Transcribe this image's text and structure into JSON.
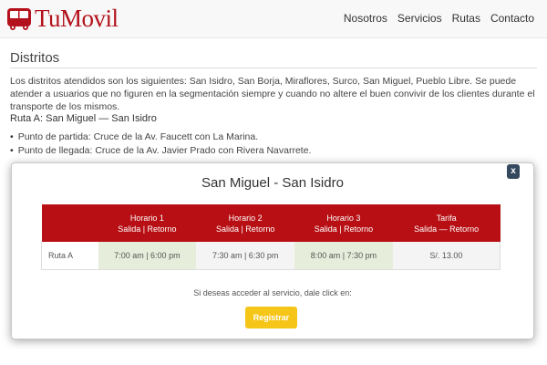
{
  "brand": {
    "name": "TuMovil",
    "color": "#b3121c"
  },
  "nav": {
    "items": [
      "Nosotros",
      "Servicios",
      "Rutas",
      "Contacto"
    ]
  },
  "page": {
    "title": "Distritos",
    "intro": "Los distritos atendidos son los siguientes: San Isidro, San Borja, Miraflores, Surco, San Miguel, Pueblo Libre. Se puede atender a usuarios que no figuren en la segmentación siempre y cuando no altere el buen convivir de los clientes durante el transporte de los mismos.",
    "route_heading": "Ruta A: San Miguel — San Isidro",
    "route_points": [
      "Punto de partida: Cruce de la Av. Faucett con La Marina.",
      "Punto de llegada: Cruce de la Av. Javier Prado con Rivera Navarrete."
    ]
  },
  "modal": {
    "close_label": "x",
    "title": "San Miguel - San Isidro",
    "table": {
      "headers": [
        {
          "title": "",
          "sub": ""
        },
        {
          "title": "Horario 1",
          "sub": "Salida | Retorno"
        },
        {
          "title": "Horario 2",
          "sub": "Salida | Retorno"
        },
        {
          "title": "Horario 3",
          "sub": "Salida | Retorno"
        },
        {
          "title": "Tarifa",
          "sub": "Salida — Retorno"
        }
      ],
      "row": {
        "label": "Ruta A",
        "cells": [
          "7:00 am | 6:00 pm",
          "7:30 am | 6:30 pm",
          "8:00 am | 7:30 pm",
          "S/. 13.00"
        ]
      },
      "header_color": "#b70f13"
    },
    "register_text": "Si deseas acceder al servicio, dale click en:",
    "register_button": "Registrar",
    "button_color": "#f5c518"
  }
}
